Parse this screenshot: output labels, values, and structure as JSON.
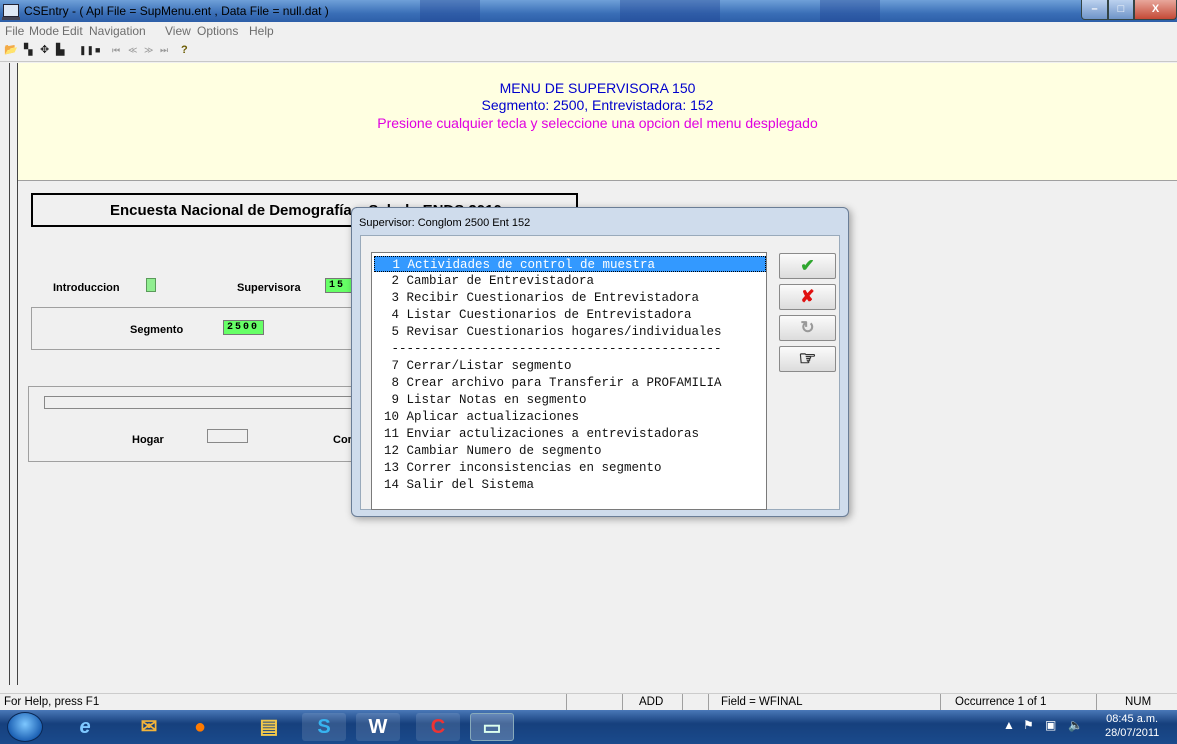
{
  "window": {
    "title": "CSEntry - ( Apl File = SupMenu.ent , Data File = null.dat )"
  },
  "menu": [
    "File",
    "Mode",
    "Edit",
    "Navigation",
    "View",
    "Options",
    "Help"
  ],
  "toolbar": {
    "icons": [
      "open-icon",
      "add-icon",
      "insert-icon",
      "modify-icon",
      "pause-icon",
      "stop-icon",
      "first-icon",
      "prev-icon",
      "next-icon",
      "last-icon",
      "help-icon"
    ],
    "glyphs": [
      "📂",
      "▚",
      "✥",
      "▙",
      "❚❚",
      "■",
      "⏮",
      "≪",
      "≫",
      "⏭",
      "?"
    ]
  },
  "message": {
    "line1": "MENU DE SUPERVISORA 150",
    "line2": "Segmento: 2500, Entrevistadora: 152",
    "line3": "Presione cualquier tecla y seleccione una opcion del menu desplegado"
  },
  "form": {
    "title": "Encuesta Nacional de Demografía y Salud - ENDS 2010",
    "introduccion_label": "Introduccion",
    "supervisora_label": "Supervisora",
    "supervisora_value": "15",
    "segmento_label": "Segmento",
    "segmento_value": "2500",
    "hogar_label": "Hogar",
    "cor_label": "Cor"
  },
  "dialog": {
    "title": "Supervisor: Conglom 2500 Ent 152",
    "items": [
      " 1 Actividades de control de muestra",
      " 2 Cambiar de Entrevistadora",
      " 3 Recibir Cuestionarios de Entrevistadora",
      " 4 Listar Cuestionarios de Entrevistadora",
      " 5 Revisar Cuestionarios hogares/individuales",
      " --------------------------------------------",
      " 7 Cerrar/Listar segmento",
      " 8 Crear archivo para Transferir a PROFAMILIA",
      " 9 Listar Notas en segmento",
      "10 Aplicar actualizaciones",
      "11 Enviar actulizaciones a entrevistadoras",
      "12 Cambiar Numero de segmento",
      "13 Correr inconsistencias en segmento",
      "14 Salir del Sistema"
    ],
    "selected_index": 0,
    "buttons": {
      "ok_glyph": "✔",
      "cancel_glyph": "✘",
      "refresh_glyph": "↻",
      "point_glyph": "☞"
    }
  },
  "statusbar": {
    "help": "For Help, press F1",
    "mode": "ADD",
    "field": "Field = WFINAL",
    "occurrence": "Occurrence 1 of 1",
    "num": "NUM"
  },
  "taskbar": {
    "apps": [
      "internet-explorer-icon",
      "outlook-icon",
      "media-player-icon",
      "file-explorer-icon",
      "skype-icon",
      "word-icon",
      "cspro-icon",
      "csentry-icon"
    ],
    "tray": {
      "time": "08:45 a.m.",
      "date": "28/07/2011"
    }
  },
  "colors": {
    "message_bg": "#ffffe1",
    "message_blue": "#0000cc",
    "message_magenta": "#e000e0",
    "field_green": "#66ff66",
    "selection_blue": "#3399ff"
  }
}
